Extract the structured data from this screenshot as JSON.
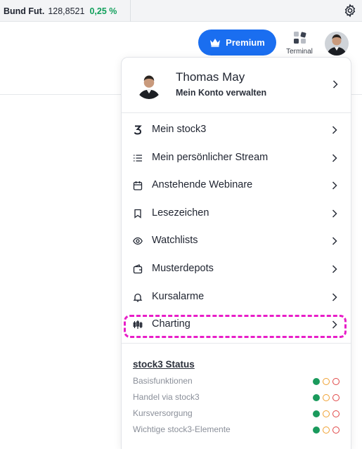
{
  "ticker": {
    "name": "Bund Fut.",
    "value": "128,8521",
    "change": "0,25 %"
  },
  "header": {
    "premium_label": "Premium",
    "terminal_label": "Terminal"
  },
  "profile": {
    "name": "Thomas May",
    "subtitle": "Mein Konto verwalten"
  },
  "menu": {
    "items": [
      {
        "label": "Mein stock3",
        "icon": "stock3-logo-icon"
      },
      {
        "label": "Mein persönlicher Stream",
        "icon": "list-icon"
      },
      {
        "label": "Anstehende Webinare",
        "icon": "calendar-icon"
      },
      {
        "label": "Lesezeichen",
        "icon": "bookmark-icon"
      },
      {
        "label": "Watchlists",
        "icon": "eye-icon"
      },
      {
        "label": "Musterdepots",
        "icon": "wallet-icon"
      },
      {
        "label": "Kursalarme",
        "icon": "bell-icon"
      },
      {
        "label": "Charting",
        "icon": "candlestick-icon"
      }
    ]
  },
  "status": {
    "title": "stock3 Status",
    "rows": [
      {
        "label": "Basisfunktionen"
      },
      {
        "label": "Handel via stock3"
      },
      {
        "label": "Kursversorgung"
      },
      {
        "label": "Wichtige stock3-Elemente"
      }
    ]
  },
  "colors": {
    "accent": "#1a6ef0",
    "positive": "#12a05c",
    "highlight": "#e81ec8",
    "status_ok": "#1a9a5c",
    "status_warn": "#f0a030",
    "status_error": "#e04545"
  }
}
